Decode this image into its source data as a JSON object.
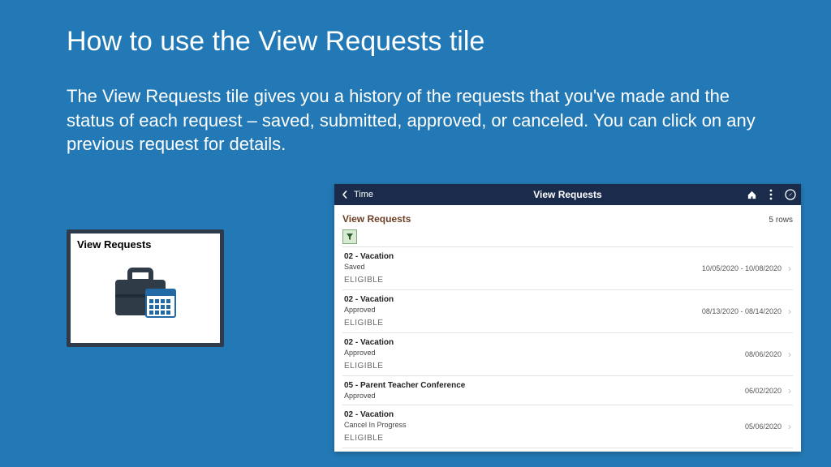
{
  "slide": {
    "title": "How to use the View Requests tile",
    "body": "The View Requests tile gives you a history of the requests that you've made and the status of each request – saved, submitted, approved, or canceled. You can click on any previous request for details."
  },
  "tile": {
    "title": "View Requests"
  },
  "app": {
    "back_label": "Time",
    "title": "View Requests",
    "section_title": "View Requests",
    "row_count_label": "5 rows",
    "rows": [
      {
        "type": "02 - Vacation",
        "status": "Saved",
        "eligible": "ELIGIBLE",
        "date": "10/05/2020 - 10/08/2020"
      },
      {
        "type": "02 - Vacation",
        "status": "Approved",
        "eligible": "ELIGIBLE",
        "date": "08/13/2020 - 08/14/2020"
      },
      {
        "type": "02 - Vacation",
        "status": "Approved",
        "eligible": "ELIGIBLE",
        "date": "08/06/2020"
      },
      {
        "type": "05 - Parent Teacher Conference",
        "status": "Approved",
        "eligible": "",
        "date": "06/02/2020"
      },
      {
        "type": "02 - Vacation",
        "status": "Cancel In Progress",
        "eligible": "ELIGIBLE",
        "date": "05/06/2020"
      }
    ]
  }
}
